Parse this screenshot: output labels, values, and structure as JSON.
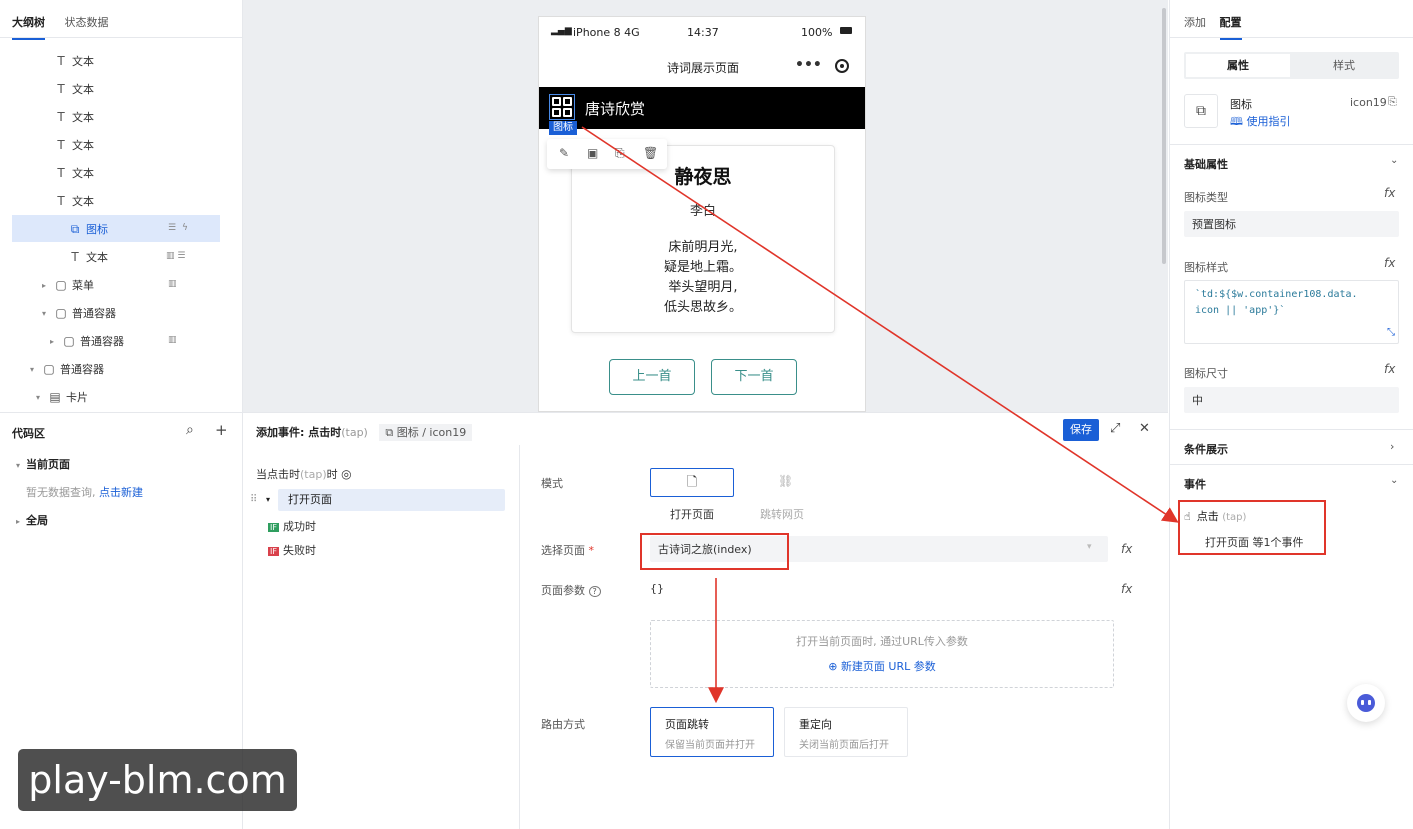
{
  "left_panel": {
    "tabs": [
      "大纲树",
      "状态数据"
    ],
    "tree": [
      {
        "label": "文本",
        "icon": "T"
      },
      {
        "label": "文本",
        "icon": "T"
      },
      {
        "label": "文本",
        "icon": "T"
      },
      {
        "label": "文本",
        "icon": "T"
      },
      {
        "label": "文本",
        "icon": "T"
      },
      {
        "label": "文本",
        "icon": "T"
      },
      {
        "label": "图标",
        "icon": "⧉",
        "selected": true
      },
      {
        "label": "文本",
        "icon": "T"
      },
      {
        "label": "菜单",
        "icon": "▢"
      },
      {
        "label": "普通容器",
        "icon": "▢"
      },
      {
        "label": "普通容器",
        "icon": "▢"
      },
      {
        "label": "普通容器",
        "icon": "▢"
      },
      {
        "label": "卡片",
        "icon": "▤"
      }
    ],
    "code_area": {
      "title": "代码区",
      "current_page": "当前页面",
      "empty_text": "暂无数据查询,",
      "new_link": "点击新建",
      "global": "全局"
    }
  },
  "phone": {
    "status": {
      "signal": "iPhone 8  4G",
      "time": "14:37",
      "battery": "100%"
    },
    "nav_title": "诗词展示页面",
    "header_title": "唐诗欣赏",
    "icon_tag": "图标",
    "poem": {
      "title": "静夜思",
      "author": "李白",
      "lines": [
        "床前明月光,",
        "疑是地上霜。",
        "举头望明月,",
        "低头思故乡。"
      ]
    },
    "prev_button": "上一首",
    "next_button": "下一首"
  },
  "event_panel": {
    "title": "添加事件: 点击时",
    "title_suffix": "(tap)",
    "component": "图标 / icon19",
    "save_label": "保存",
    "trigger_prefix": "当点击时",
    "trigger_tap": "(tap)",
    "trigger_suffix": "时",
    "action": "打开页面",
    "success": "成功时",
    "fail": "失败时",
    "if_badge": "IF",
    "mode_label": "模式",
    "mode_options": [
      "打开页面",
      "跳转网页"
    ],
    "page_label": "选择页面",
    "page_value": "古诗词之旅(index)",
    "params_label": "页面参数",
    "params_value": "{}",
    "params_hint": "打开当前页面时, 通过URL传入参数",
    "params_add": "新建页面 URL 参数",
    "route_label": "路由方式",
    "route_options": [
      {
        "title": "页面跳转",
        "desc": "保留当前页面并打开"
      },
      {
        "title": "重定向",
        "desc": "关闭当前页面后打开"
      }
    ]
  },
  "right_panel": {
    "tabs": [
      "添加",
      "配置"
    ],
    "segments": [
      "属性",
      "样式"
    ],
    "component_name": "图标",
    "component_id": "icon19",
    "guide_link": "使用指引",
    "basic_props": "基础属性",
    "icon_type_label": "图标类型",
    "icon_type_value": "预置图标",
    "icon_style_label": "图标样式",
    "icon_style_code_1": "`td:${$w.container108.data.",
    "icon_style_code_2": "icon || 'app'}`",
    "icon_size_label": "图标尺寸",
    "icon_size_value": "中",
    "condition_display": "条件展示",
    "events_title": "事件",
    "event_name": "点击",
    "event_tap": "(tap)",
    "event_desc": "打开页面 等1个事件",
    "fx": "fx"
  },
  "watermark": "play-blm.com",
  "colors": {
    "accent": "#1a5fd6",
    "teal": "#3a8f8a",
    "annotation_red": "#e0352a"
  }
}
